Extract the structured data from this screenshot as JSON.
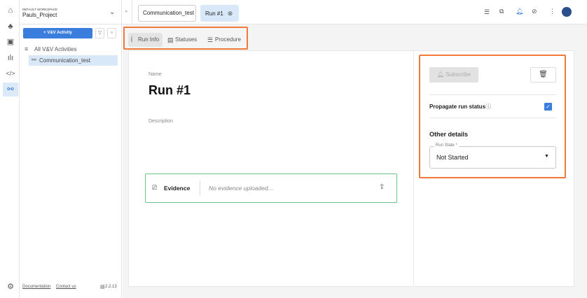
{
  "sidebar": {
    "workspace_label": "DEFAULT WORKSPACE",
    "project": "Pauls_Project",
    "add_button": "+ V&V Activity",
    "all_label": "All V&V Activities",
    "tree_item": "Communication_test",
    "footer": {
      "documentation": "Documentation",
      "contact": "Contact us",
      "version": "2.2.13"
    }
  },
  "tabs": [
    {
      "label": "Communication_test"
    },
    {
      "label": "Run #1"
    }
  ],
  "subtabs": [
    "Run Info",
    "Statuses",
    "Procedure"
  ],
  "run": {
    "name_label": "Name",
    "name": "Run #1",
    "description_label": "Description",
    "evidence_label": "Evidence",
    "evidence_placeholder": "No evidence uploaded..."
  },
  "details": {
    "subscribe": "Subscribe",
    "propagate_label": "Propagate run status",
    "propagate_checked": true,
    "other_details": "Other details",
    "run_state_label": "Run State *",
    "run_state_value": "Not Started"
  },
  "colors": {
    "accent": "#3b7ddd",
    "highlight": "#f07a3c",
    "evidence_border": "#6cc486"
  }
}
